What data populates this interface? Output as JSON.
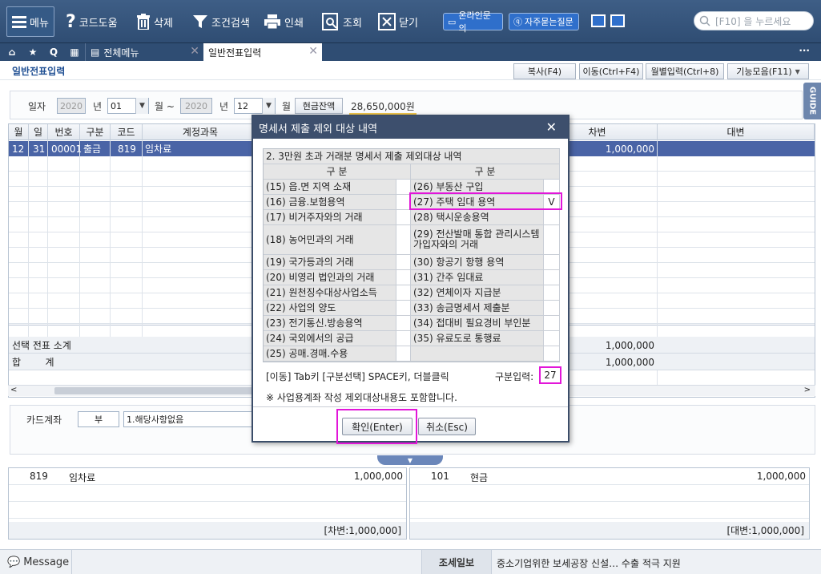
{
  "toolbar": {
    "menu": "메뉴",
    "code_help": "코드도움",
    "delete": "삭제",
    "cond_search": "조건검색",
    "print": "인쇄",
    "inquiry": "조회",
    "close": "닫기",
    "online_inquiry": "온라인문의",
    "faq": "자주묻는질문",
    "search_placeholder": "[F10] 을 누르세요"
  },
  "tabs": {
    "all_menu": "전체메뉴",
    "active": "일반전표입력",
    "more": "···"
  },
  "page": {
    "title": "일반전표입력",
    "buttons": {
      "copy": "복사(F4)",
      "move": "이동(Ctrl+F4)",
      "monthly": "월별입력(Ctrl+8)",
      "functions": "기능모음(F11)"
    },
    "guide": "GUIDE"
  },
  "condition": {
    "date_label": "일자",
    "year1": "2020",
    "year_unit": "년",
    "month1": "01",
    "month_unit_tilde": "월 ~",
    "year2": "2020",
    "month2": "12",
    "month_unit": "월",
    "cash_balance_label": "현금잔액",
    "cash_balance_value": "28,650,000원"
  },
  "grid": {
    "headers": [
      "월",
      "일",
      "번호",
      "구분",
      "코드",
      "계정과목",
      "차변",
      "대변"
    ],
    "selected_row": {
      "month": "12",
      "day": "31",
      "no": "00001",
      "type": "출금",
      "code": "819",
      "account": "임차료",
      "debit": "1,000,000",
      "credit": ""
    },
    "subtotal_label": "선택 전표 소계",
    "subtotal_debit": "1,000,000",
    "total_label": "합        계",
    "total_debit": "1,000,000"
  },
  "card": {
    "label": "카드계좌",
    "code": "부",
    "value": "1.해당사항없음"
  },
  "journal": {
    "left": {
      "code": "819",
      "account": "임차료",
      "amount": "1,000,000",
      "total": "[차변:1,000,000]"
    },
    "right": {
      "code": "101",
      "account": "현금",
      "amount": "1,000,000",
      "total": "[대변:1,000,000]"
    }
  },
  "status": {
    "message": "Message",
    "tax_news_label": "조세일보",
    "tax_news_text": "중소기업위한 보세공장 신설… 수출 적극 지원"
  },
  "dialog": {
    "title": "명세서 제출 제외 대상 내역",
    "section_title": "2. 3만원 초과 거래분 명세서 제출 제외대상 내역",
    "col_header": "구  분",
    "left_items": [
      "(15) 읍.면 지역 소재",
      "(16) 금융.보험용역",
      "(17) 비거주자와의 거래",
      "(18) 농어민과의 거래",
      "(19) 국가등과의 거래",
      "(20) 비영리 법인과의 거래",
      "(21) 원천징수대상사업소득",
      "(22) 사업의 양도",
      "(23) 전기통신.방송용역",
      "(24) 국외에서의 공급",
      "(25) 공매.경매.수용"
    ],
    "right_items": [
      "(26) 부동산 구입",
      "(27) 주택 임대 용역",
      "(28) 택시운송용역",
      "(29) 전산발매 통합 관리시스템 가입자와의 거래",
      "(30) 항공기 항행 용역",
      "(31) 간주 임대료",
      "(32) 연체이자 지급분",
      "(33) 송금명세서 제출분",
      "(34) 접대비 필요경비 부인분",
      "(35) 유료도로 통행료",
      ""
    ],
    "right_marks": [
      "",
      "V",
      "",
      "",
      "",
      "",
      "",
      "",
      "",
      "",
      ""
    ],
    "hint": "[이동] Tab키 [구분선택] SPACE키, 더블클릭",
    "input_label": "구분입력:",
    "input_value": "27",
    "note": "※ 사업용계좌 작성 제외대상내용도 포함합니다.",
    "confirm": "확인(Enter)",
    "cancel": "취소(Esc)"
  }
}
